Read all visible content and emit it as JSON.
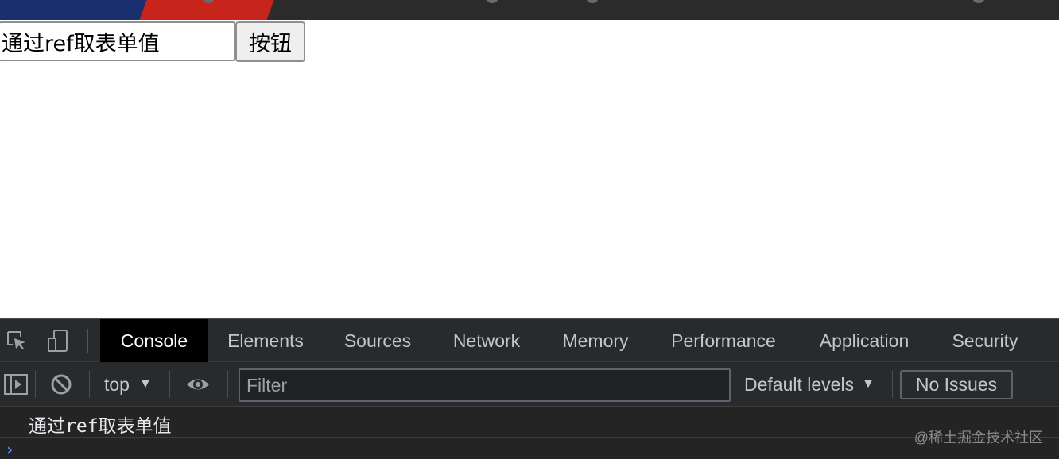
{
  "page": {
    "input_value": "通过ref取表单值",
    "button_label": "按钮"
  },
  "devtools": {
    "tabs": [
      {
        "label": "Console",
        "active": true
      },
      {
        "label": "Elements",
        "active": false
      },
      {
        "label": "Sources",
        "active": false
      },
      {
        "label": "Network",
        "active": false
      },
      {
        "label": "Memory",
        "active": false
      },
      {
        "label": "Performance",
        "active": false
      },
      {
        "label": "Application",
        "active": false
      },
      {
        "label": "Security",
        "active": false
      }
    ],
    "toolbar": {
      "context": "top",
      "filter_placeholder": "Filter",
      "levels": "Default levels",
      "issues": "No Issues"
    },
    "console_output": "通过ref取表单值",
    "prompt_symbol": "›"
  },
  "watermark": "@稀土掘金技术社区",
  "icons": [
    "inspect-element-icon",
    "device-toggle-icon",
    "sidebar-toggle-icon",
    "clear-console-icon",
    "eye-icon",
    "dropdown-arrow-icon"
  ],
  "colors": {
    "devtools_bg": "#292a2d",
    "active_tab_bg": "#000000",
    "prompt": "#4f8bf5",
    "top_strip_red": "#c7251c",
    "top_strip_blue": "#1b2f6e"
  }
}
